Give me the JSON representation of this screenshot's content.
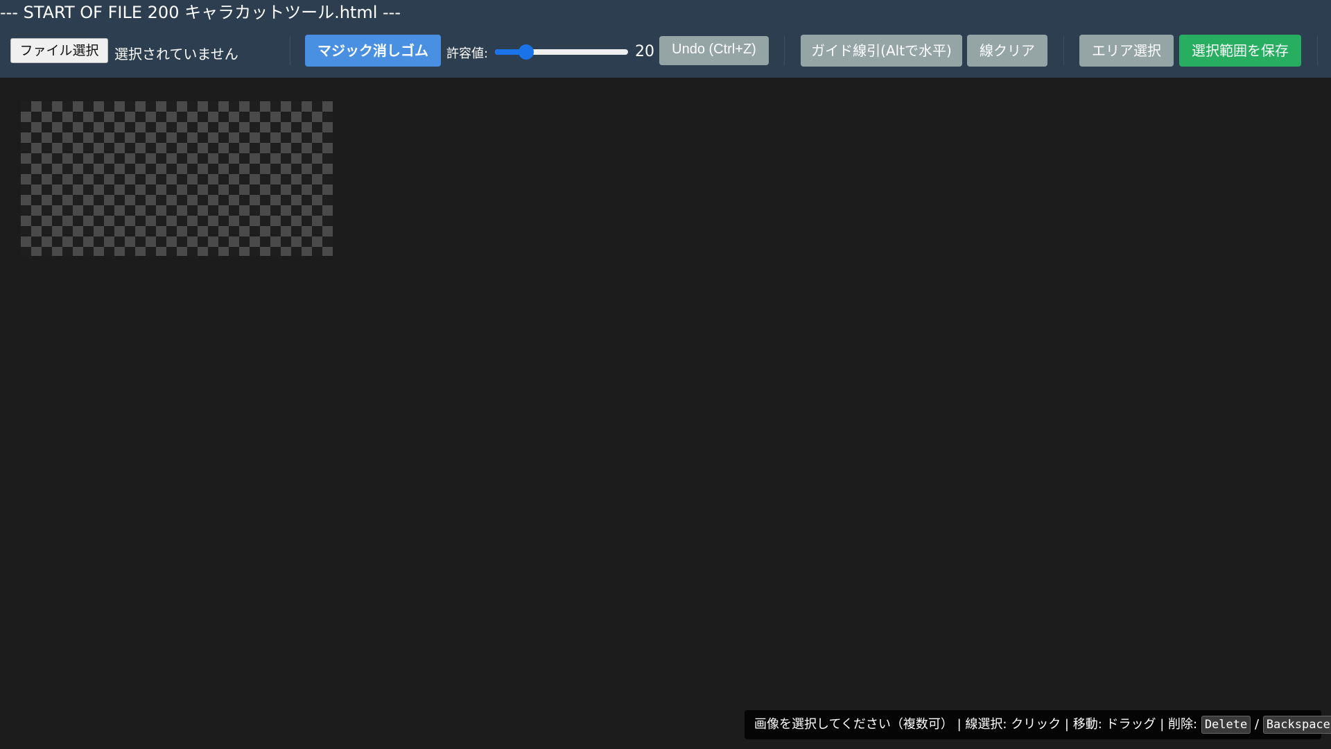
{
  "title_bar": "--- START OF FILE 200 キャラカットツール.html ---",
  "file": {
    "button_label": "ファイル選択",
    "status": "選択されていません"
  },
  "toolbar": {
    "magic_eraser_label": "マジック消しゴム",
    "tolerance_label": "許容値:",
    "tolerance_value": "20",
    "tolerance_fraction": 0.2,
    "undo_label": "Undo (Ctrl+Z)",
    "guide_line_label": "ガイド線引(Altで水平)",
    "clear_lines_label": "線クリア",
    "area_select_label": "エリア選択",
    "save_selection_label": "選択範囲を保存"
  },
  "status_bar": {
    "text": "画像を選択してください（複数可） | 線選択: クリック | 移動: ドラッグ | 削除: ",
    "key_delete": "Delete",
    "key_separator": "/",
    "key_backspace": "Backspace"
  },
  "colors": {
    "toolbar_bg": "#2d3e50",
    "canvas_bg": "#1c1c1c",
    "magic_button": "#4a90e2",
    "grey_button": "#95a5a6",
    "save_button": "#27ae60",
    "slider_accent": "#1a73e8"
  }
}
